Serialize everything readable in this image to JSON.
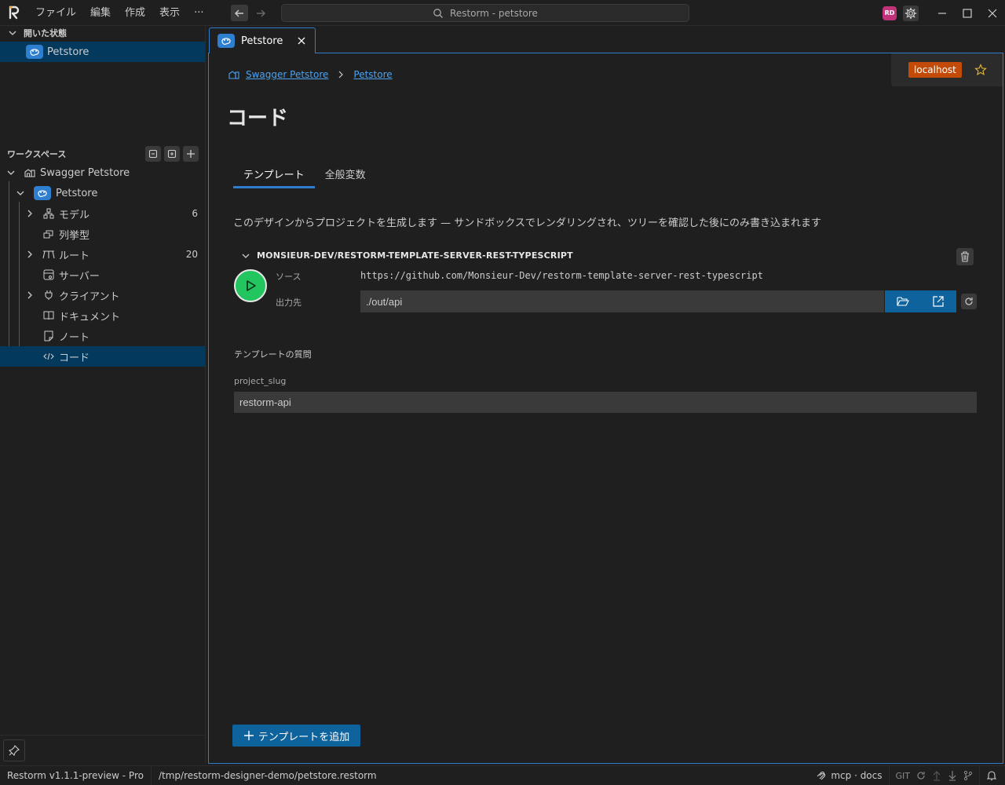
{
  "titlebar": {
    "menu": [
      "ファイル",
      "編集",
      "作成",
      "表示",
      "···"
    ],
    "search_text": "Restorm - petstore",
    "avatar_initials": "RD"
  },
  "sidebar": {
    "open_editors_title": "開いた状態",
    "open_editors": [
      {
        "label": "Petstore",
        "icon": "petstore-icon"
      }
    ],
    "workspace_title": "ワークスペース",
    "workspace_root": "Swagger Petstore",
    "api": "Petstore",
    "items": [
      {
        "label": "モデル",
        "icon": "model-icon",
        "count": "6",
        "expandable": true
      },
      {
        "label": "列挙型",
        "icon": "enum-icon",
        "count": "",
        "expandable": false
      },
      {
        "label": "ルート",
        "icon": "route-icon",
        "count": "20",
        "expandable": true
      },
      {
        "label": "サーバー",
        "icon": "server-icon",
        "count": "",
        "expandable": false
      },
      {
        "label": "クライアント",
        "icon": "plug-icon",
        "count": "",
        "expandable": true
      },
      {
        "label": "ドキュメント",
        "icon": "book-icon",
        "count": "",
        "expandable": false
      },
      {
        "label": "ノート",
        "icon": "note-icon",
        "count": "",
        "expandable": false
      },
      {
        "label": "コード",
        "icon": "code-icon",
        "count": "",
        "expandable": false,
        "selected": true
      }
    ]
  },
  "tab": {
    "label": "Petstore"
  },
  "editor": {
    "environment": "localhost",
    "breadcrumb": [
      "Swagger Petstore",
      "Petstore"
    ],
    "title": "コード",
    "subtabs": [
      "テンプレート",
      "全般変数"
    ],
    "description": "このデザインからプロジェクトを生成します — サンドボックスでレンダリングされ、ツリーを確認した後にのみ書き込まれます",
    "template": {
      "name": "MONSIEUR-DEV/RESTORM-TEMPLATE-SERVER-REST-TYPESCRIPT",
      "source_label": "ソース",
      "source_url": "https://github.com/Monsieur-Dev/restorm-template-server-rest-typescript",
      "output_label": "出力先",
      "output_value": "./out/api"
    },
    "questions_title": "テンプレートの質問",
    "slug_label": "project_slug",
    "slug_value": "restorm-api",
    "add_template": "テンプレートを追加"
  },
  "statusbar": {
    "version": "Restorm v1.1.1-preview - Pro",
    "path": "/tmp/restorm-designer-demo/petstore.restorm",
    "mcp": "mcp · docs",
    "git": "GIT"
  },
  "colors": {
    "accent": "#2e7ccc",
    "selected": "#04395e",
    "env_badge": "#c24b0a",
    "run": "#22c55e",
    "button": "#0e639c"
  }
}
